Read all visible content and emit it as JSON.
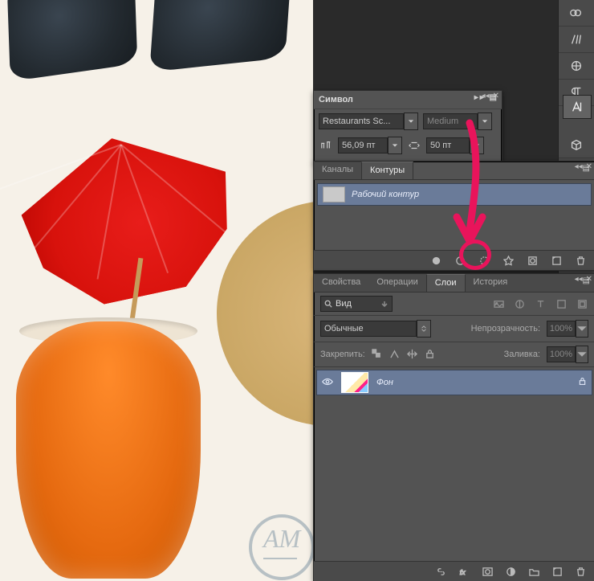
{
  "char_panel": {
    "title": "Символ",
    "font_family": "Restaurants Sc...",
    "font_style": "Medium",
    "font_size": "56,09 пт",
    "leading": "50 пт"
  },
  "paths_panel": {
    "tabs": {
      "channels": "Каналы",
      "paths": "Контуры"
    },
    "active_tab": "paths",
    "work_path": "Рабочий контур"
  },
  "layers_panel": {
    "tabs": {
      "properties": "Свойства",
      "actions": "Операции",
      "layers": "Слои",
      "history": "История"
    },
    "active_tab": "layers",
    "filter_kind": "Вид",
    "blend_mode": "Обычные",
    "opacity_label": "Непрозрачность:",
    "opacity_value": "100%",
    "lock_label": "Закрепить:",
    "fill_label": "Заливка:",
    "fill_value": "100%",
    "layer": {
      "name": "Фон",
      "visible": true,
      "locked": true
    }
  },
  "rtool": {
    "selected": "character-icon"
  }
}
